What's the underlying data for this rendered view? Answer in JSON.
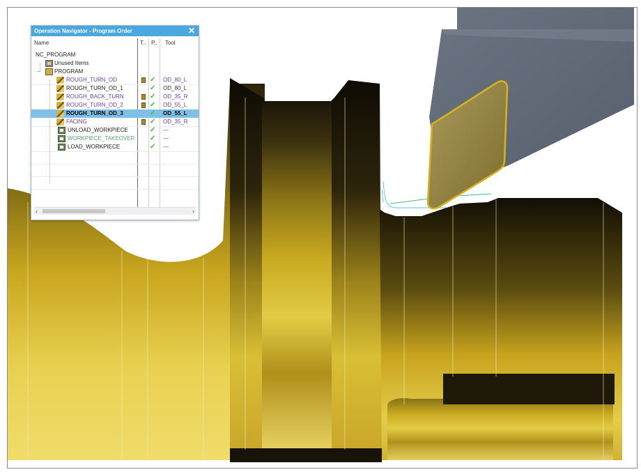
{
  "dialog": {
    "title": "Operation Navigator - Program Order",
    "close": "✕",
    "columns": {
      "name": "Name",
      "t": "T..",
      "p": "P..",
      "tool": "Tool"
    },
    "rows": [
      {
        "label": "NC_PROGRAM",
        "tool": "",
        "check": ""
      },
      {
        "label": "Unused Items",
        "tool": "",
        "check": ""
      },
      {
        "label": "PROGRAM",
        "tool": "",
        "check": ""
      },
      {
        "label": "ROUGH_TURN_OD",
        "tool": "OD_80_L",
        "check": "✓"
      },
      {
        "label": "ROUGH_TURN_OD_1",
        "tool": "OD_80_L",
        "check": "✓"
      },
      {
        "label": "ROUGH_BACK_TURN",
        "tool": "OD_35_R",
        "check": "✓"
      },
      {
        "label": "ROUGH_TURN_OD_2",
        "tool": "OD_55_L",
        "check": "✓"
      },
      {
        "label": "ROUGH_TURN_OD_3",
        "tool": "OD_55_L",
        "check": "✓"
      },
      {
        "label": "FACING",
        "tool": "OD_35_R",
        "check": "✓"
      },
      {
        "label": "UNLOAD_WORKPIECE",
        "tool": "---",
        "check": "✓"
      },
      {
        "label": "WORKPIECE_TAKEOVER",
        "tool": "---",
        "check": "✓"
      },
      {
        "label": "LOAD_WORKPIECE",
        "tool": "---",
        "check": "✓"
      }
    ],
    "scroll_left": "‹",
    "scroll_right": "›"
  },
  "colors": {
    "part_gold": "#c9a21c",
    "part_dark": "#1a1508",
    "holder": "#5f6876",
    "insert": "#8c7c3a",
    "selection": "#7fc0e6",
    "title_bar": "#4aa7e0"
  }
}
